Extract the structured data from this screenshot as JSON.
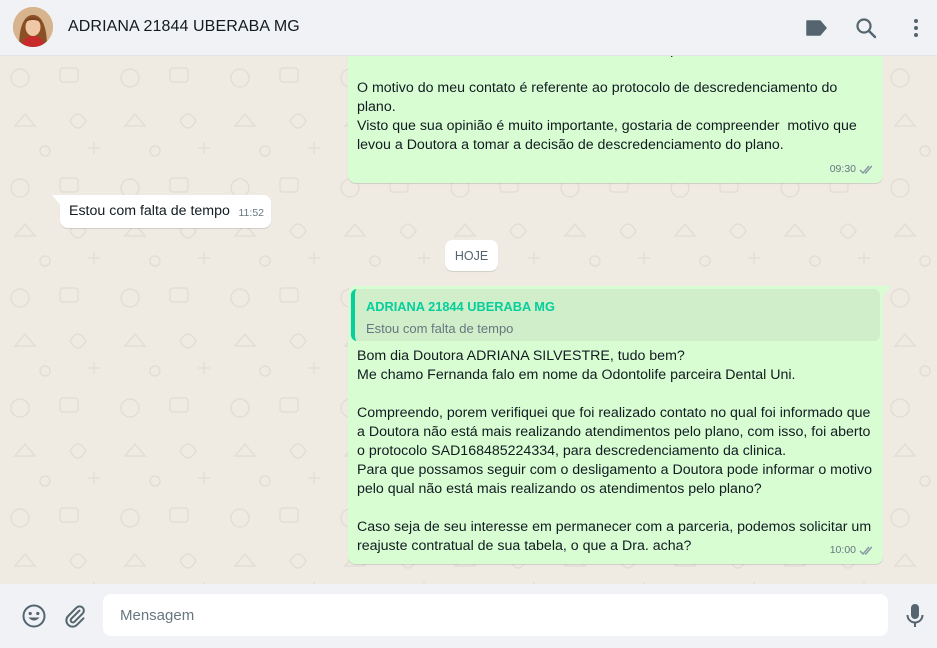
{
  "header": {
    "contact_name": "ADRIANA 21844 UBERABA MG",
    "icons": [
      "label-icon",
      "search-icon",
      "menu-icon"
    ]
  },
  "messages": [
    {
      "direction": "outgoing",
      "text": "Me chamo Fernanda falo em nome da Odontolife parceira Dental Uni.\n\nO motivo do meu contato é referente ao protocolo de descredenciamento do plano.\nVisto que sua opinião é muito importante, gostaria de compreender  motivo que levou a Doutora a tomar a decisão de descredenciamento do plano.",
      "time": "09:30",
      "status": "read"
    },
    {
      "direction": "incoming",
      "text": "Estou com falta de tempo",
      "time": "11:52"
    },
    {
      "direction": "outgoing",
      "quoted_author": "ADRIANA 21844 UBERABA MG",
      "quoted_text": "Estou com falta de tempo",
      "text": "Bom dia Doutora ADRIANA SILVESTRE, tudo bem?\nMe chamo Fernanda falo em nome da Odontolife parceira Dental Uni.\n\nCompreendo, porem verifiquei que foi realizado contato no qual foi informado que a Doutora não está mais realizando atendimentos pelo plano, com isso, foi aberto o protocolo SAD168485224334, para descredenciamento da clinica.\nPara que possamos seguir com o desligamento a Doutora pode informar o motivo pelo qual não está mais realizando os atendimentos pelo plano?\n\nCaso seja de seu interesse em permanecer com a parceria, podemos solicitar um reajuste contratual de sua tabela, o que a Dra. acha?",
      "time": "10:00",
      "status": "read"
    }
  ],
  "day_divider": "HOJE",
  "composer": {
    "placeholder": "Mensagem",
    "value": ""
  },
  "colors": {
    "outgoing_bubble": "#d9fdd3",
    "incoming_bubble": "#ffffff",
    "chat_background": "#efeae2",
    "accent": "#06cf9c",
    "read_ticks": "#8696a0"
  }
}
